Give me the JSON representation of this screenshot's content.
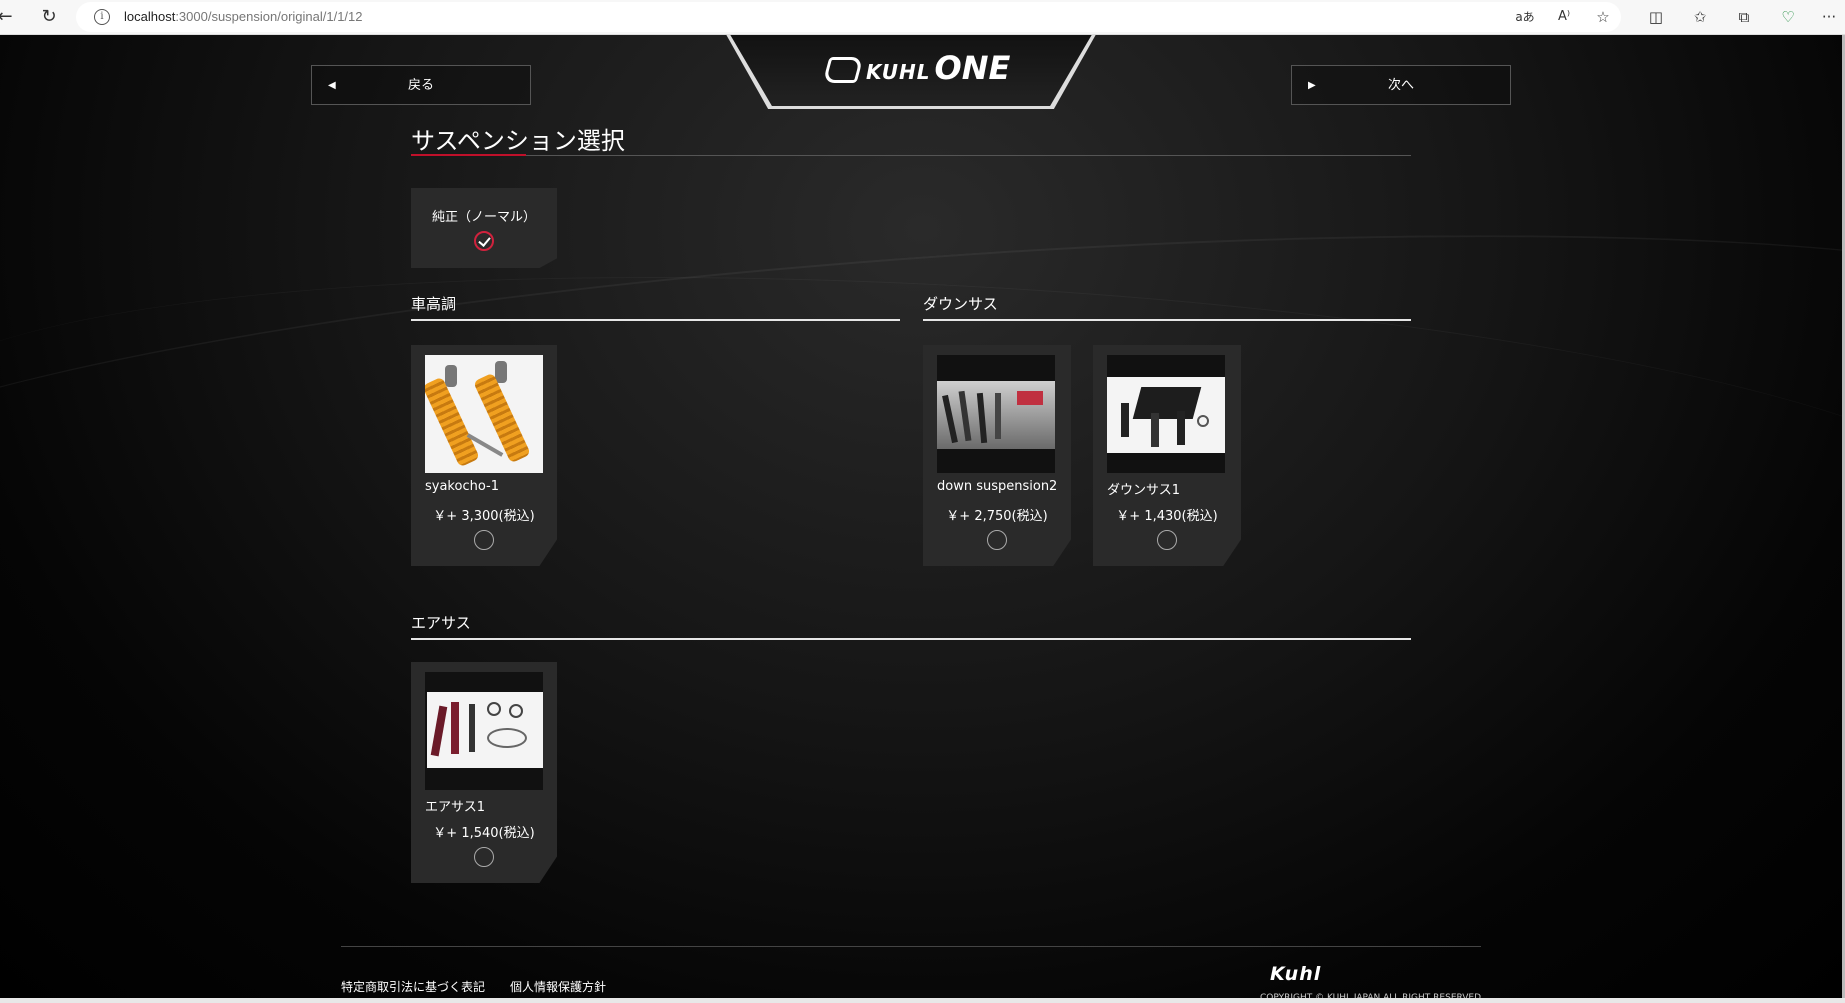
{
  "browser": {
    "url_host": "localhost",
    "url_path": ":3000/suspension/original/1/1/12",
    "icons": [
      "back-icon",
      "reload-icon",
      "info-icon",
      "translate-icon",
      "read-aloud-icon",
      "favorite-icon",
      "split-screen-icon",
      "favorites-icon",
      "collections-icon",
      "browser-essentials-icon",
      "more-icon"
    ],
    "tool_glyphs": {
      "translate": "aあ",
      "read_aloud": "A⁾",
      "favorite": "☆",
      "split": "◫",
      "favorites": "✩",
      "collections": "⧉",
      "essentials": "♡",
      "more": "···"
    }
  },
  "nav": {
    "prev_label": "戻る",
    "next_label": "次へ"
  },
  "logo": {
    "brand": "KUHL",
    "product": "ONE"
  },
  "page_title": "サスペンション選択",
  "genuine": {
    "label": "純正（ノーマル）",
    "selected": true
  },
  "categories": [
    {
      "title": "車高調",
      "items": [
        {
          "name": "syakocho-1",
          "price": "￥+ 3,300(税込)",
          "selected": false
        }
      ]
    },
    {
      "title": "ダウンサス",
      "items": [
        {
          "name": "down suspension2",
          "price": "￥+ 2,750(税込)",
          "selected": false
        },
        {
          "name": "ダウンサス1",
          "price": "￥+ 1,430(税込)",
          "selected": false
        }
      ]
    },
    {
      "title": "エアサス",
      "items": [
        {
          "name": "エアサス1",
          "price": "￥+ 1,540(税込)",
          "selected": false
        }
      ]
    }
  ],
  "footer": {
    "link1": "特定商取引法に基づく表記",
    "link2": "個人情報保護方針",
    "logo": "Kuhl",
    "copyright": "COPYRIGHT © KUHL JAPAN ALL RIGHT RESERVED."
  },
  "colors": {
    "accent_red": "#c0102a",
    "card_bg": "#2a2a2a",
    "page_bg": "#000000"
  }
}
